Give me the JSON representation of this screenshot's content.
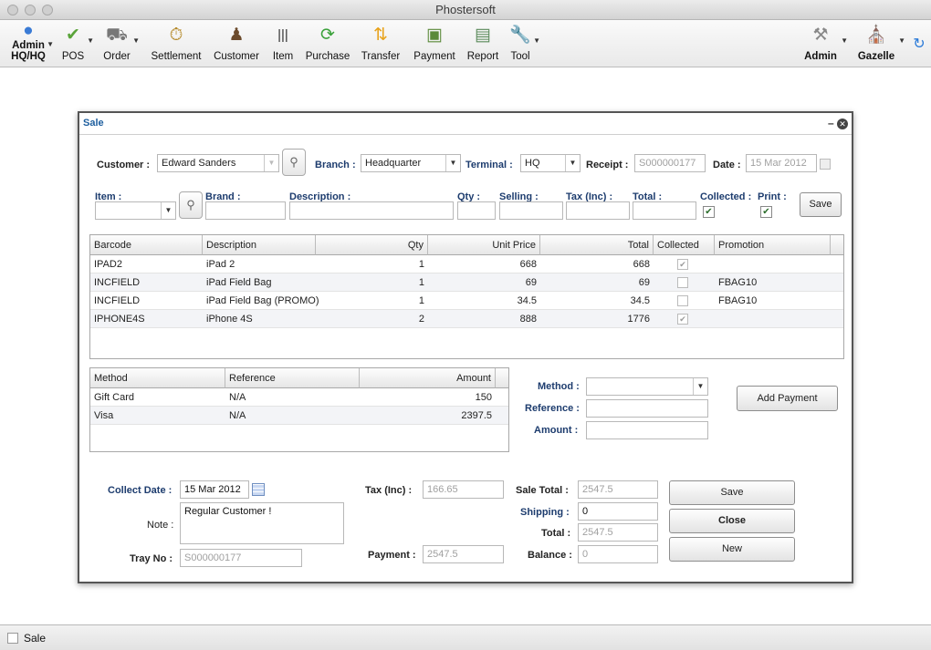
{
  "app": {
    "title": "Phostersoft"
  },
  "toolbar": {
    "admin_hq": "Admin\nHQ/HQ",
    "items": [
      "POS",
      "Order",
      "Settlement",
      "Customer",
      "Item",
      "Purchase",
      "Transfer",
      "Payment",
      "Report",
      "Tool"
    ],
    "right_admin": "Admin",
    "right_gazelle": "Gazelle"
  },
  "window": {
    "title": "Sale"
  },
  "header": {
    "customer_label": "Customer :",
    "customer_value": "Edward Sanders",
    "branch_label": "Branch :",
    "branch_value": "Headquarter",
    "terminal_label": "Terminal :",
    "terminal_value": "HQ",
    "receipt_label": "Receipt :",
    "receipt_value": "S000000177",
    "date_label": "Date :",
    "date_value": "15 Mar 2012"
  },
  "entry": {
    "item_label": "Item :",
    "brand_label": "Brand :",
    "description_label": "Description :",
    "qty_label": "Qty :",
    "selling_label": "Selling :",
    "tax_label": "Tax (Inc) :",
    "total_label": "Total :",
    "collected_label": "Collected :",
    "print_label": "Print :",
    "save_label": "Save"
  },
  "items_table": {
    "columns": [
      "Barcode",
      "Description",
      "Qty",
      "Unit Price",
      "Total",
      "Collected",
      "Promotion"
    ],
    "rows": [
      {
        "barcode": "IPAD2",
        "description": "iPad 2",
        "qty": "1",
        "unit_price": "668",
        "total": "668",
        "collected": true,
        "promotion": ""
      },
      {
        "barcode": "INCFIELD",
        "description": "iPad Field Bag",
        "qty": "1",
        "unit_price": "69",
        "total": "69",
        "collected": false,
        "promotion": "FBAG10"
      },
      {
        "barcode": "INCFIELD",
        "description": "iPad Field Bag (PROMO)",
        "qty": "1",
        "unit_price": "34.5",
        "total": "34.5",
        "collected": false,
        "promotion": "FBAG10"
      },
      {
        "barcode": "IPHONE4S",
        "description": "iPhone 4S",
        "qty": "2",
        "unit_price": "888",
        "total": "1776",
        "collected": true,
        "promotion": ""
      }
    ]
  },
  "payment_table": {
    "columns": [
      "Method",
      "Reference",
      "Amount"
    ],
    "rows": [
      {
        "method": "Gift Card",
        "reference": "N/A",
        "amount": "150"
      },
      {
        "method": "Visa",
        "reference": "N/A",
        "amount": "2397.5"
      }
    ]
  },
  "payment_entry": {
    "method_label": "Method :",
    "reference_label": "Reference :",
    "amount_label": "Amount :",
    "add_payment_label": "Add Payment"
  },
  "footer": {
    "collect_date_label": "Collect Date :",
    "collect_date_value": "15 Mar 2012",
    "note_label": "Note :",
    "note_value": "Regular Customer !",
    "tray_label": "Tray No :",
    "tray_value": "S000000177",
    "tax_label": "Tax (Inc) :",
    "tax_value": "166.65",
    "payment_label": "Payment :",
    "payment_value": "2547.5",
    "sale_total_label": "Sale Total :",
    "sale_total_value": "2547.5",
    "shipping_label": "Shipping :",
    "shipping_value": "0",
    "total_label": "Total :",
    "total_value": "2547.5",
    "balance_label": "Balance :",
    "balance_value": "0",
    "save_label": "Save",
    "close_label": "Close",
    "new_label": "New"
  },
  "status": {
    "text": "Sale"
  }
}
